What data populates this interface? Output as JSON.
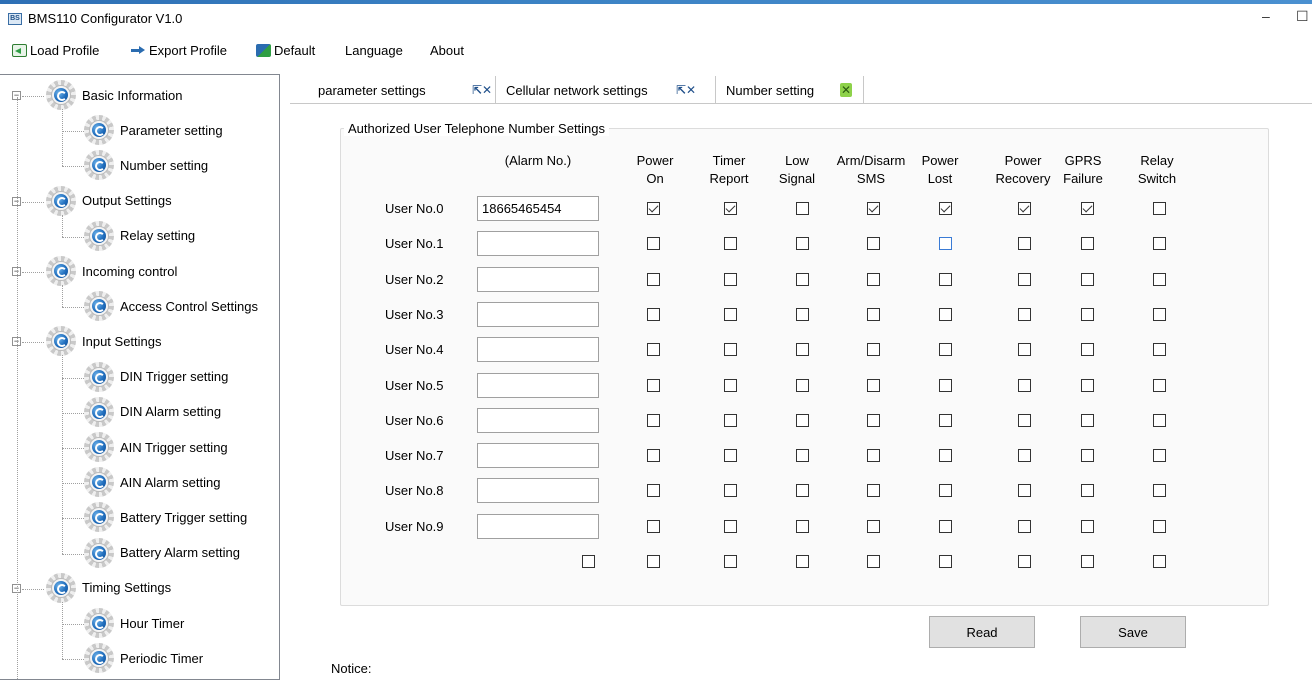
{
  "window": {
    "title": "BMS110 Configurator V1.0",
    "minimize": "–",
    "maximize": "☐"
  },
  "menu": {
    "load_profile": "Load Profile",
    "export_profile": "Export Profile",
    "default": "Default",
    "language": "Language",
    "about": "About"
  },
  "tree": {
    "groups": [
      {
        "label": "Basic Information",
        "children": [
          "Parameter setting",
          "Number setting"
        ]
      },
      {
        "label": "Output Settings",
        "children": [
          "Relay setting"
        ]
      },
      {
        "label": "Incoming control",
        "children": [
          "Access Control Settings"
        ]
      },
      {
        "label": "Input Settings",
        "children": [
          "DIN Trigger setting",
          "DIN Alarm setting",
          "AIN Trigger setting",
          "AIN Alarm setting",
          "Battery Trigger setting",
          "Battery Alarm setting"
        ]
      },
      {
        "label": "Timing Settings",
        "children": [
          "Hour Timer",
          "Periodic Timer"
        ]
      }
    ]
  },
  "tabs": [
    {
      "label": "parameter settings"
    },
    {
      "label": "Cellular network settings"
    },
    {
      "label": "Number setting",
      "active": true
    }
  ],
  "number_settings": {
    "group_title": "Authorized User Telephone Number Settings",
    "alarm_col_header": "(Alarm No.)",
    "columns": [
      [
        "Power",
        "On"
      ],
      [
        "Timer",
        "Report"
      ],
      [
        "Low",
        "Signal"
      ],
      [
        "Arm/Disarm",
        "SMS"
      ],
      [
        "Power",
        "Lost"
      ],
      [
        "Power",
        "Recovery"
      ],
      [
        "GPRS",
        "Failure"
      ],
      [
        "Relay",
        "Switch"
      ]
    ],
    "rows": [
      {
        "label": "User No.0",
        "number": "18665465454",
        "checks": [
          true,
          true,
          false,
          true,
          true,
          true,
          true,
          false
        ]
      },
      {
        "label": "User No.1",
        "number": "",
        "checks": [
          false,
          false,
          false,
          false,
          false,
          false,
          false,
          false
        ]
      },
      {
        "label": "User No.2",
        "number": "",
        "checks": [
          false,
          false,
          false,
          false,
          false,
          false,
          false,
          false
        ]
      },
      {
        "label": "User No.3",
        "number": "",
        "checks": [
          false,
          false,
          false,
          false,
          false,
          false,
          false,
          false
        ]
      },
      {
        "label": "User No.4",
        "number": "",
        "checks": [
          false,
          false,
          false,
          false,
          false,
          false,
          false,
          false
        ]
      },
      {
        "label": "User No.5",
        "number": "",
        "checks": [
          false,
          false,
          false,
          false,
          false,
          false,
          false,
          false
        ]
      },
      {
        "label": "User No.6",
        "number": "",
        "checks": [
          false,
          false,
          false,
          false,
          false,
          false,
          false,
          false
        ]
      },
      {
        "label": "User No.7",
        "number": "",
        "checks": [
          false,
          false,
          false,
          false,
          false,
          false,
          false,
          false
        ]
      },
      {
        "label": "User No.8",
        "number": "",
        "checks": [
          false,
          false,
          false,
          false,
          false,
          false,
          false,
          false
        ]
      },
      {
        "label": "User No.9",
        "number": "",
        "checks": [
          false,
          false,
          false,
          false,
          false,
          false,
          false,
          false
        ]
      }
    ],
    "select_all_checks": [
      false,
      false,
      false,
      false,
      false,
      false,
      false,
      false,
      false
    ]
  },
  "buttons": {
    "read": "Read",
    "save": "Save"
  },
  "notice_label": "Notice:",
  "colors": {
    "accent": "#1f6dbd",
    "active_tab_close": "#8ed24a",
    "focus_checkbox": "#3a7bd5"
  }
}
